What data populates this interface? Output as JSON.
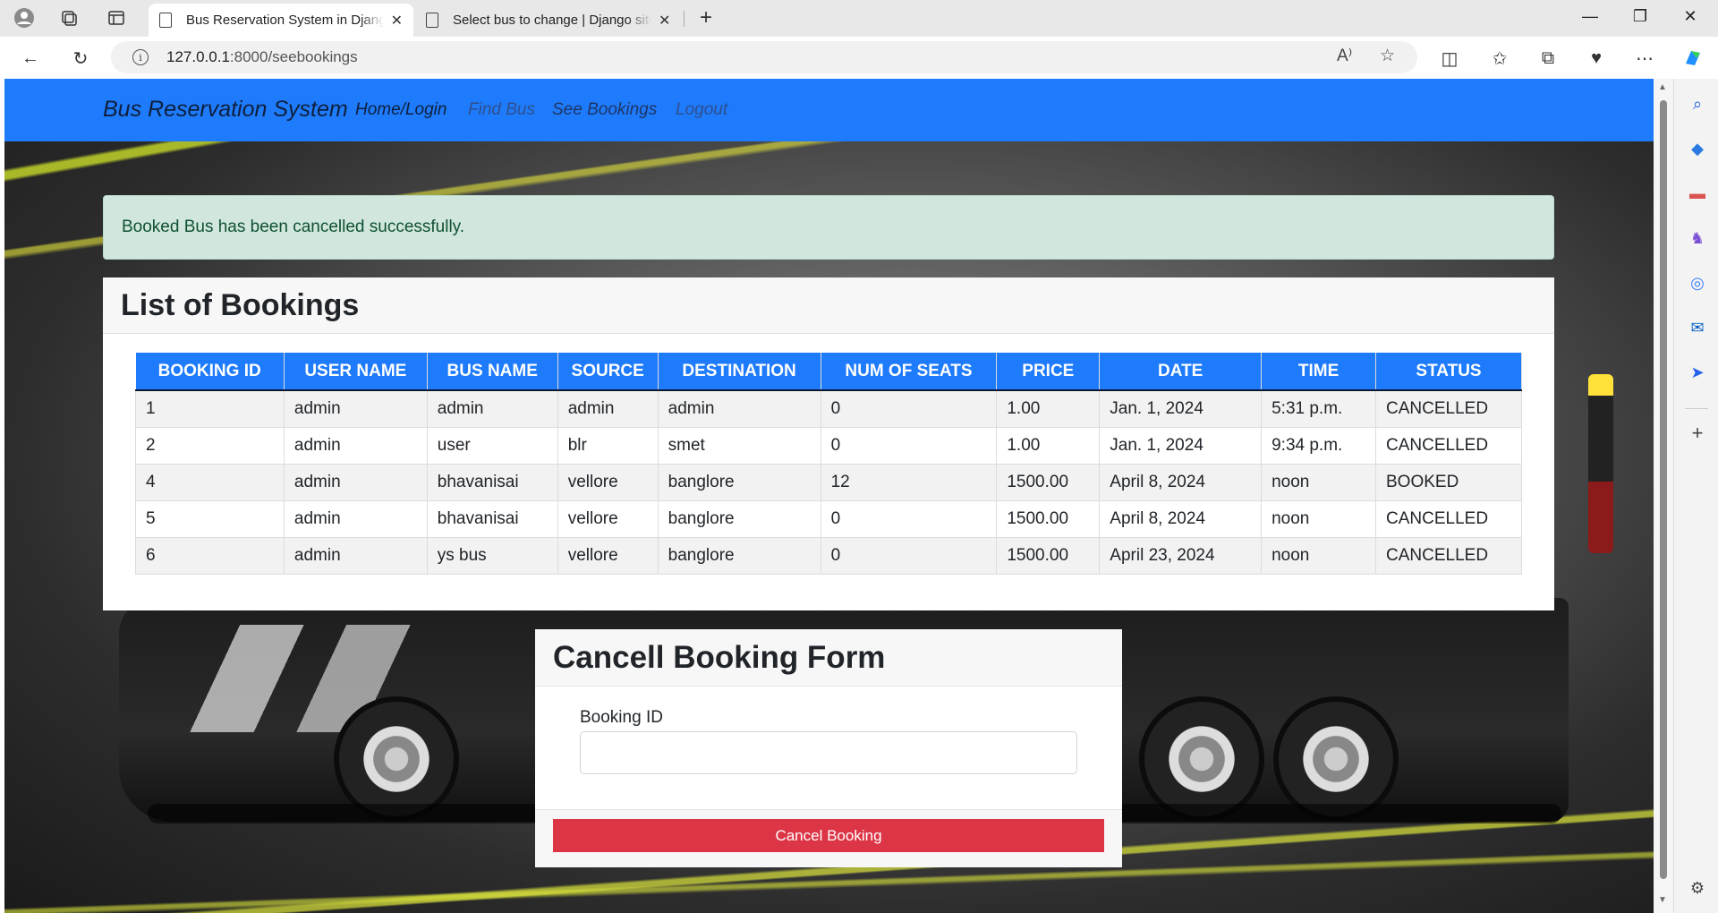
{
  "browser": {
    "tabs": [
      {
        "title": "Bus Reservation System in Django",
        "active": true
      },
      {
        "title": "Select bus to change | Django site admin",
        "active": false
      }
    ],
    "url_host": "127.0.0.1",
    "url_path": ":8000/seebookings"
  },
  "navbar": {
    "brand": "Bus Reservation System",
    "links": [
      {
        "label": "Home/Login",
        "color": "#0f1f3d"
      },
      {
        "label": "Find Bus",
        "color": "#2f4f8f"
      },
      {
        "label": "See Bookings",
        "color": "#1f3566"
      },
      {
        "label": "Logout",
        "color": "#2f4f8f"
      }
    ]
  },
  "alert": {
    "message": "Booked Bus has been cancelled successfully."
  },
  "bookings": {
    "title": "List of Bookings",
    "columns": [
      "BOOKING ID",
      "USER NAME",
      "BUS NAME",
      "SOURCE",
      "DESTINATION",
      "NUM OF SEATS",
      "PRICE",
      "DATE",
      "TIME",
      "STATUS"
    ],
    "rows": [
      [
        "1",
        "admin",
        "admin",
        "admin",
        "admin",
        "0",
        "1.00",
        "Jan. 1, 2024",
        "5:31 p.m.",
        "CANCELLED"
      ],
      [
        "2",
        "admin",
        "user",
        "blr",
        "smet",
        "0",
        "1.00",
        "Jan. 1, 2024",
        "9:34 p.m.",
        "CANCELLED"
      ],
      [
        "4",
        "admin",
        "bhavanisai",
        "vellore",
        "banglore",
        "12",
        "1500.00",
        "April 8, 2024",
        "noon",
        "BOOKED"
      ],
      [
        "5",
        "admin",
        "bhavanisai",
        "vellore",
        "banglore",
        "0",
        "1500.00",
        "April 8, 2024",
        "noon",
        "CANCELLED"
      ],
      [
        "6",
        "admin",
        "ys bus",
        "vellore",
        "banglore",
        "0",
        "1500.00",
        "April 23, 2024",
        "noon",
        "CANCELLED"
      ]
    ]
  },
  "cancel_form": {
    "title": "Cancell Booking Form",
    "field_label": "Booking ID",
    "field_value": "",
    "button_label": "Cancel Booking"
  },
  "colors": {
    "navbar": "#1e7bfb",
    "alert_bg": "#d1e7dd",
    "table_header": "#1e7bfb",
    "danger": "#dc3545"
  }
}
